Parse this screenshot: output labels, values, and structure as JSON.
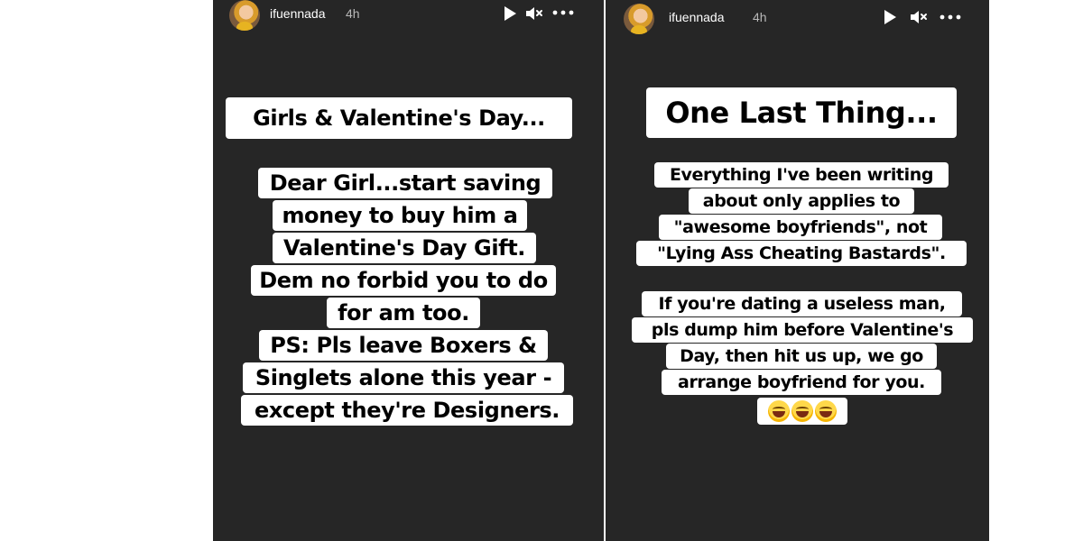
{
  "stories": [
    {
      "username": "ifuennada",
      "time": "4h",
      "icons": [
        "avatar",
        "play-icon",
        "mute-icon",
        "more-options-icon"
      ],
      "title": "Girls & Valentine's Day...",
      "lines": [
        "Dear Girl...start saving",
        "money to buy him a",
        "Valentine's Day Gift.",
        "Dem no forbid you to do",
        "for am too.",
        "PS: Pls leave Boxers &",
        "Singlets alone this year -",
        "except they're Designers."
      ]
    },
    {
      "username": "ifuennada",
      "time": "4h",
      "icons": [
        "avatar",
        "play-icon",
        "mute-icon",
        "more-options-icon"
      ],
      "title": "One Last Thing...",
      "paragraph1": [
        "Everything I've been writing",
        "about only applies to",
        "\"awesome boyfriends\", not",
        "\"Lying Ass Cheating Bastards\"."
      ],
      "paragraph2": [
        "If you're dating a useless man,",
        "pls dump him before Valentine's",
        "Day, then hit us up, we go",
        "arrange boyfriend for you."
      ],
      "emoji": [
        "grinning-sweat-emoji",
        "grinning-sweat-emoji",
        "grinning-sweat-emoji"
      ]
    }
  ],
  "colors": {
    "page_bg": "#ffffff",
    "story_bg": "#262626",
    "text_box_bg": "#ffffff",
    "text": "#000000",
    "username": "#ffffff",
    "timeago": "#b8b8b8"
  }
}
